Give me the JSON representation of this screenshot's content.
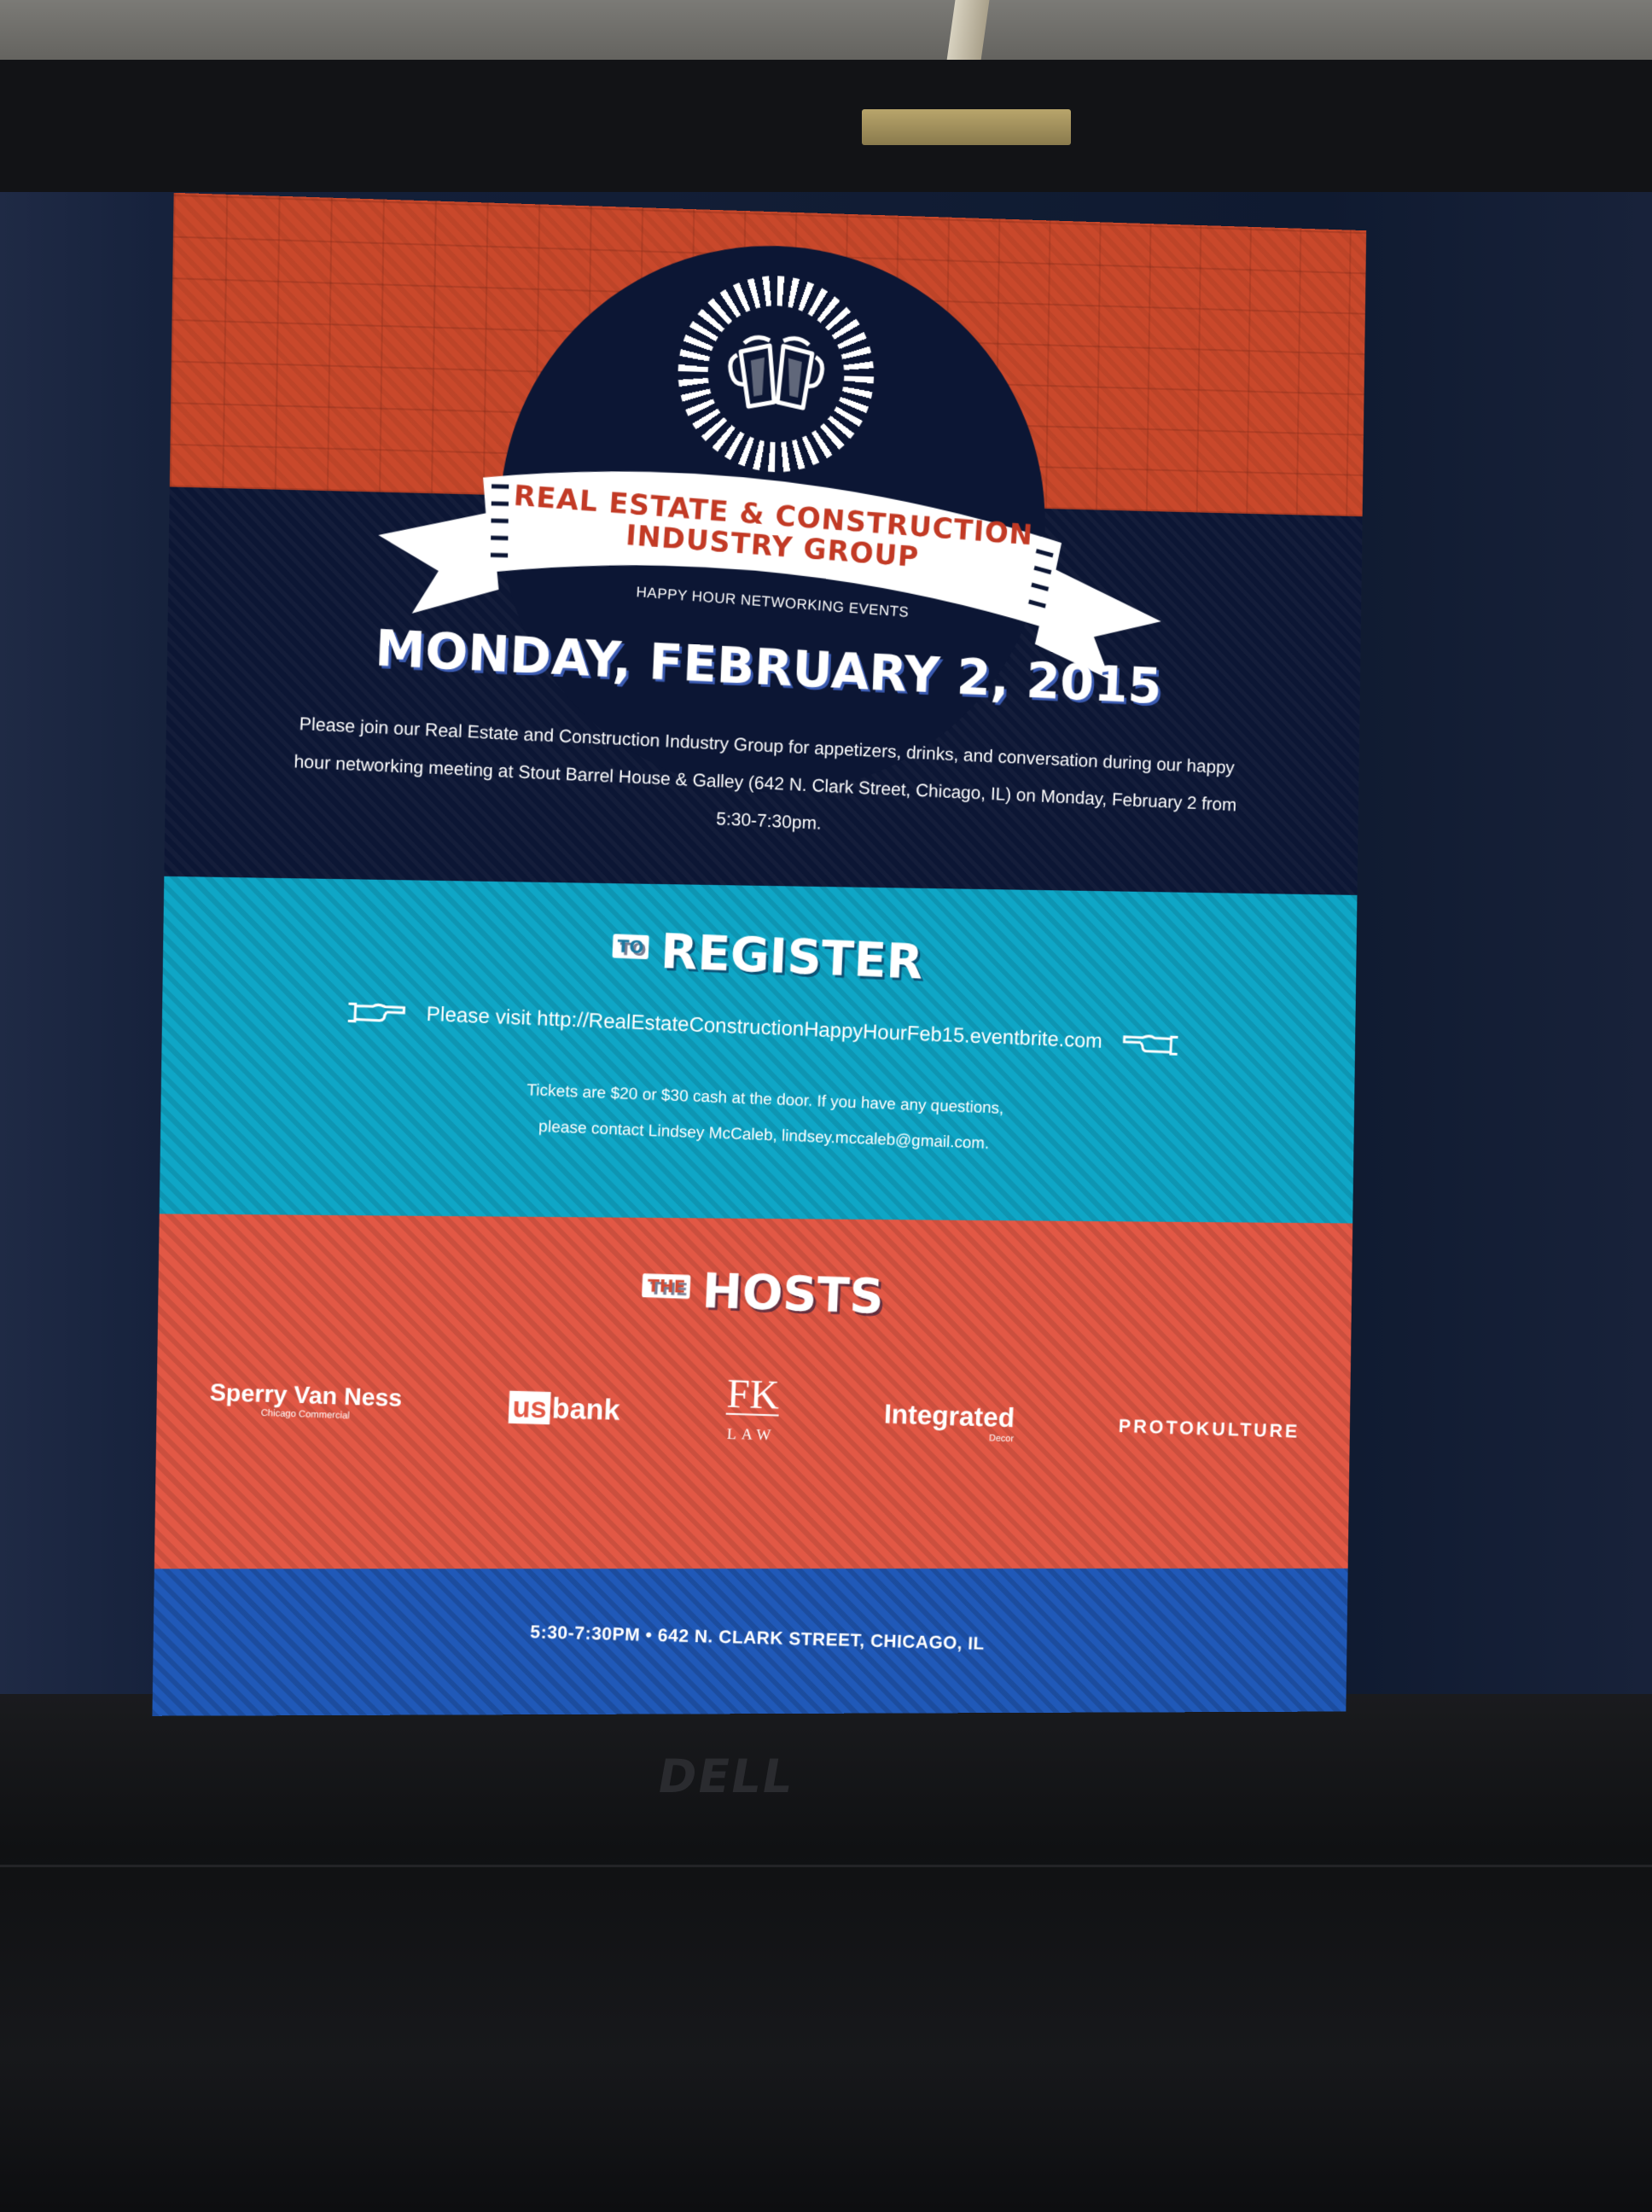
{
  "device": {
    "brand_mark": "DELL"
  },
  "email": {
    "logo": {
      "title_line1": "REAL ESTATE & CONSTRUCTION",
      "title_line2": "INDUSTRY GROUP",
      "subtitle": "HAPPY HOUR NETWORKING EVENTS"
    },
    "date_heading": "MONDAY, FEBRUARY 2, 2015",
    "intro": "Please join our Real Estate and Construction Industry Group for appetizers, drinks, and conversation during our happy hour networking meeting at Stout Barrel House & Galley (642 N. Clark Street, Chicago, IL) on Monday, February 2 from 5:30-7:30pm.",
    "register": {
      "tag": "TO",
      "heading": "REGISTER",
      "visit_text": "Please visit http://RealEstateConstructionHappyHourFeb15.eventbrite.com",
      "ticket_line1": "Tickets are $20 or $30 cash at the door. If you have any questions,",
      "ticket_line2": "please contact Lindsey McCaleb, lindsey.mccaleb@gmail.com."
    },
    "hosts": {
      "tag": "THE",
      "heading": "HOSTS",
      "logos": [
        {
          "name": "Sperry Van Ness",
          "sub": "Chicago Commercial"
        },
        {
          "prefix": "us",
          "name": "bank"
        },
        {
          "name": "FK",
          "sub": "LAW"
        },
        {
          "name": "Integrated",
          "sub": "Decor"
        },
        {
          "name": "PROTOKULTURE"
        }
      ]
    },
    "footer": "5:30-7:30PM • 642 N. CLARK STREET, CHICAGO, IL"
  },
  "colors": {
    "orange": "#c9482b",
    "navy": "#0c1634",
    "teal": "#0fa6c6",
    "coral": "#e25845",
    "blue": "#2059b8"
  },
  "icons": [
    "beer-mugs-icon",
    "pointing-hand-right-icon",
    "pointing-hand-left-icon"
  ]
}
